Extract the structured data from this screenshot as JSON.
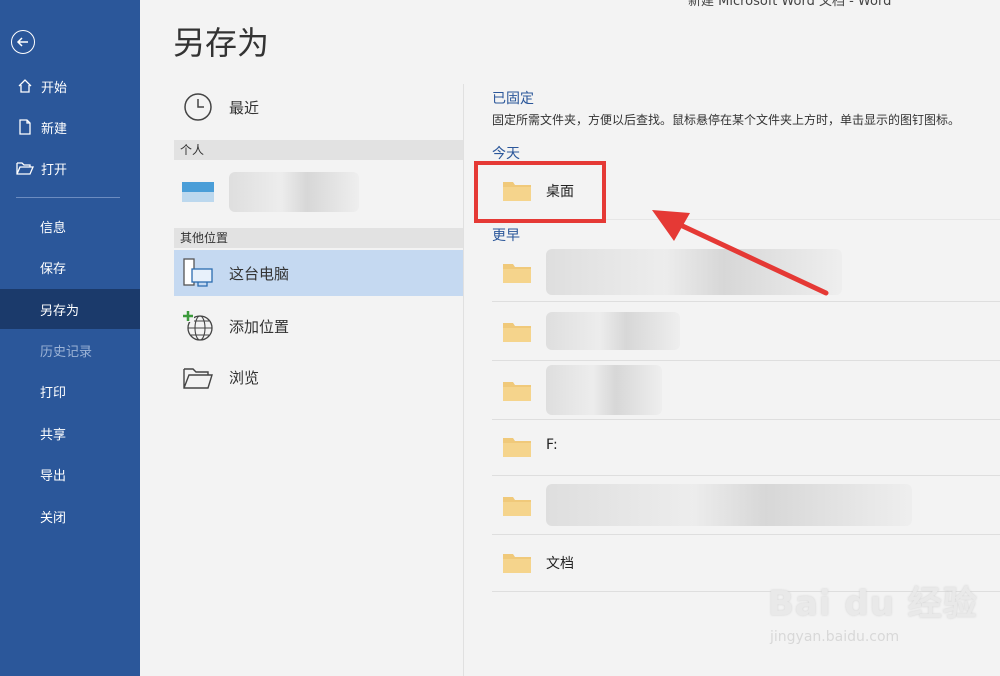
{
  "window": {
    "title": "新建 Microsoft Word 文档 - Word"
  },
  "sidebar": {
    "items": [
      {
        "label": "开始",
        "icon": "home-icon"
      },
      {
        "label": "新建",
        "icon": "new-document-icon"
      },
      {
        "label": "打开",
        "icon": "open-folder-icon"
      },
      {
        "label": "信息"
      },
      {
        "label": "保存"
      },
      {
        "label": "另存为",
        "active": true
      },
      {
        "label": "历史记录",
        "disabled": true
      },
      {
        "label": "打印"
      },
      {
        "label": "共享"
      },
      {
        "label": "导出"
      },
      {
        "label": "关闭"
      }
    ]
  },
  "page": {
    "title": "另存为"
  },
  "locations": {
    "recent": "最近",
    "personal_header": "个人",
    "other_header": "其他位置",
    "this_pc": "这台电脑",
    "add_place": "添加位置",
    "browse": "浏览"
  },
  "right": {
    "pinned_header": "已固定",
    "pinned_desc": "固定所需文件夹，方便以后查找。鼠标悬停在某个文件夹上方时，单击显示的图钉图标。",
    "today_header": "今天",
    "earlier_header": "更早",
    "today_folders": [
      {
        "name": "桌面"
      }
    ],
    "earlier_folders": [
      {
        "name": ""
      },
      {
        "name": ""
      },
      {
        "name": ""
      },
      {
        "name": "F:"
      },
      {
        "name": ""
      },
      {
        "name": "文档"
      }
    ]
  },
  "watermark": {
    "brand": "Bai du 经验",
    "url": "jingyan.baidu.com"
  },
  "colors": {
    "sidebar": "#2b579a",
    "sidebar_active": "#1b3a6b",
    "selected_location": "#c5d9f1",
    "highlight_box": "#e53935",
    "folder": "#f0c97a"
  }
}
